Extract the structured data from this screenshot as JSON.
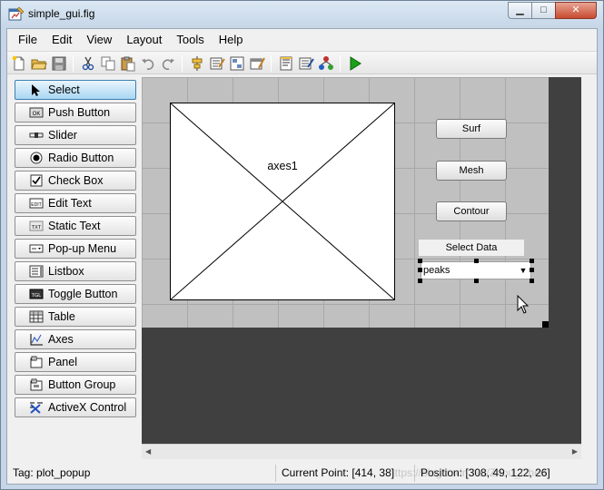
{
  "window": {
    "title": "simple_gui.fig",
    "min_glyph": "▁",
    "max_glyph": "□",
    "close_glyph": "✕"
  },
  "menu": [
    "File",
    "Edit",
    "View",
    "Layout",
    "Tools",
    "Help"
  ],
  "toolbar_icons": [
    "new-file-icon",
    "open-folder-icon",
    "save-icon",
    "cut-icon",
    "copy-icon",
    "paste-icon",
    "undo-icon",
    "redo-icon",
    "align-objects-icon",
    "menu-editor-icon",
    "tab-order-editor-icon",
    "toolbar-editor-icon",
    "editor-icon",
    "property-inspector-icon",
    "object-browser-icon",
    "run-figure-icon"
  ],
  "palette": [
    {
      "label": "Select",
      "icon": "arrow-cursor-icon",
      "selected": true
    },
    {
      "label": "Push Button",
      "icon": "push-button-icon",
      "icon_text": "OK"
    },
    {
      "label": "Slider",
      "icon": "slider-icon"
    },
    {
      "label": "Radio Button",
      "icon": "radio-button-icon"
    },
    {
      "label": "Check Box",
      "icon": "check-box-icon"
    },
    {
      "label": "Edit Text",
      "icon": "edit-text-icon",
      "icon_text": "EDIT"
    },
    {
      "label": "Static Text",
      "icon": "static-text-icon",
      "icon_text": "TXT"
    },
    {
      "label": "Pop-up Menu",
      "icon": "popup-menu-icon"
    },
    {
      "label": "Listbox",
      "icon": "listbox-icon"
    },
    {
      "label": "Toggle Button",
      "icon": "toggle-button-icon",
      "icon_text": "TGL"
    },
    {
      "label": "Table",
      "icon": "table-icon"
    },
    {
      "label": "Axes",
      "icon": "axes-icon"
    },
    {
      "label": "Panel",
      "icon": "panel-icon",
      "icon_text": "T"
    },
    {
      "label": "Button Group",
      "icon": "button-group-icon",
      "icon_text": "T"
    },
    {
      "label": "ActiveX Control",
      "icon": "activex-control-icon"
    }
  ],
  "figure": {
    "axes_label": "axes1",
    "buttons": {
      "surf": "Surf",
      "mesh": "Mesh",
      "contour": "Contour"
    },
    "select_data_label": "Select Data",
    "popup_value": "peaks",
    "popup_arrow": "▼"
  },
  "scroll": {
    "left": "◀",
    "right": "▶"
  },
  "status": {
    "tag": "Tag: plot_popup",
    "current_point": "Current Point:  [414, 38]",
    "position": "Position:  [308, 49, 122, 26]",
    "watermark": "https://blog.csdn.net/Zhou_Chen"
  },
  "colors": {
    "select_bg": "#a9d6f3",
    "canvas_bg": "#404040",
    "grid_bg": "#c0c0c0",
    "run_green": "#1aa11a"
  }
}
